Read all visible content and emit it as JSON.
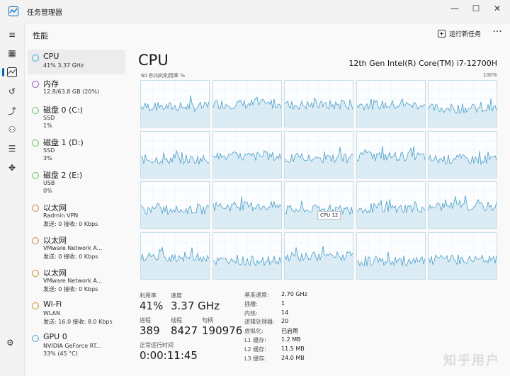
{
  "window": {
    "title": "任务管理器",
    "minimize_icon": "minimize-icon",
    "maximize_icon": "maximize-icon",
    "close_icon": "close-icon"
  },
  "header": {
    "page_title": "性能",
    "run_task_label": "运行新任务",
    "more_label": "···"
  },
  "nav_icons": [
    "hamburger-icon",
    "processes-icon",
    "performance-icon",
    "history-icon",
    "startup-icon",
    "users-icon",
    "details-icon",
    "services-icon",
    "settings-icon"
  ],
  "sidebar": {
    "items": [
      {
        "name": "CPU",
        "sub1": "41%  3.37 GHz",
        "sub2": "",
        "sub3": "",
        "color": "#4ba3d9"
      },
      {
        "name": "内存",
        "sub1": "12.8/63.8 GB (20%)",
        "sub2": "",
        "sub3": "",
        "color": "#9b59b6"
      },
      {
        "name": "磁盘 0 (C:)",
        "sub1": "SSD",
        "sub2": "1%",
        "sub3": "",
        "color": "#6abf69"
      },
      {
        "name": "磁盘 1 (D:)",
        "sub1": "SSD",
        "sub2": "3%",
        "sub3": "",
        "color": "#6abf69"
      },
      {
        "name": "磁盘 2 (E:)",
        "sub1": "USB",
        "sub2": "0%",
        "sub3": "",
        "color": "#6abf69"
      },
      {
        "name": "以太网",
        "sub1": "Radmin VPN",
        "sub2": "发送: 0 接收: 0 Kbps",
        "sub3": "",
        "color": "#c98a3a"
      },
      {
        "name": "以太网",
        "sub1": "VMware Network A...",
        "sub2": "发送: 0 接收: 0 Kbps",
        "sub3": "",
        "color": "#c98a3a"
      },
      {
        "name": "以太网",
        "sub1": "VMware Network A...",
        "sub2": "发送: 0 接收: 0 Kbps",
        "sub3": "",
        "color": "#c98a3a"
      },
      {
        "name": "Wi-Fi",
        "sub1": "WLAN",
        "sub2": "发送: 16.0 接收: 8.0 Kbps",
        "sub3": "",
        "color": "#c98a3a"
      },
      {
        "name": "GPU 0",
        "sub1": "NVIDIA GeForce RT...",
        "sub2": "33% (45 °C)",
        "sub3": "",
        "color": "#4ba3d9"
      }
    ]
  },
  "cpu": {
    "title": "CPU",
    "model": "12th Gen Intel(R) Core(TM) i7-12700H",
    "util_label": "60 秒内的利用率 %",
    "util_max": "100%",
    "tooltip": "CPU 12",
    "graph_line_color": "#4a9fc9",
    "graph_fill_color": "#cfe4f1"
  },
  "stats": {
    "util_label": "利用率",
    "util_value": "41%",
    "speed_label": "速度",
    "speed_value": "3.37 GHz",
    "proc_label": "进程",
    "proc_value": "389",
    "thread_label": "线程",
    "thread_value": "8427",
    "handle_label": "句柄",
    "handle_value": "190976",
    "uptime_label": "正常运行时间",
    "uptime_value": "0:00:11:45"
  },
  "specs": [
    {
      "k": "基准速度:",
      "v": "2.70 GHz"
    },
    {
      "k": "插槽:",
      "v": "1"
    },
    {
      "k": "内核:",
      "v": "14"
    },
    {
      "k": "逻辑处理器:",
      "v": "20"
    },
    {
      "k": "虚拟化:",
      "v": "已启用"
    },
    {
      "k": "L1 缓存:",
      "v": "1.2 MB"
    },
    {
      "k": "L2 缓存:",
      "v": "11.5 MB"
    },
    {
      "k": "L3 缓存:",
      "v": "24.0 MB"
    }
  ],
  "watermark": "知乎用户"
}
